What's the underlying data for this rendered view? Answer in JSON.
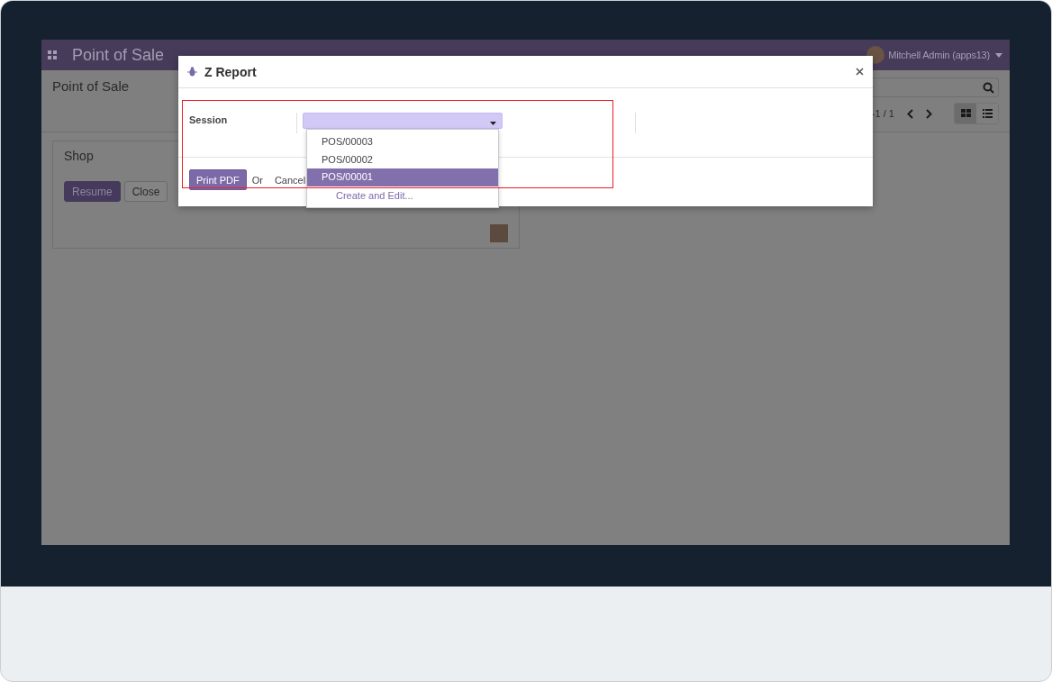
{
  "navbar": {
    "app_title": "Point of Sale",
    "user": "Mitchell Admin (apps13)"
  },
  "control_panel": {
    "breadcrumb": "Point of Sale",
    "pager": "-1 / 1",
    "views": [
      {
        "kind": "kanban",
        "selected": true
      },
      {
        "kind": "list",
        "selected": false
      }
    ]
  },
  "kanban_card": {
    "title": "Shop",
    "buttons": [
      {
        "label": "Resume",
        "kind": "primary"
      },
      {
        "label": "Close",
        "kind": "secondary"
      }
    ]
  },
  "dialog": {
    "title": "Z Report",
    "field_label": "Session",
    "options": [
      {
        "label": "POS/00003",
        "selected": false
      },
      {
        "label": "POS/00002",
        "selected": false
      },
      {
        "label": "POS/00001",
        "selected": true
      }
    ],
    "create_link": "Create and Edit...",
    "print_button": "Print PDF",
    "or_text": "Or",
    "cancel_link": "Cancel"
  }
}
